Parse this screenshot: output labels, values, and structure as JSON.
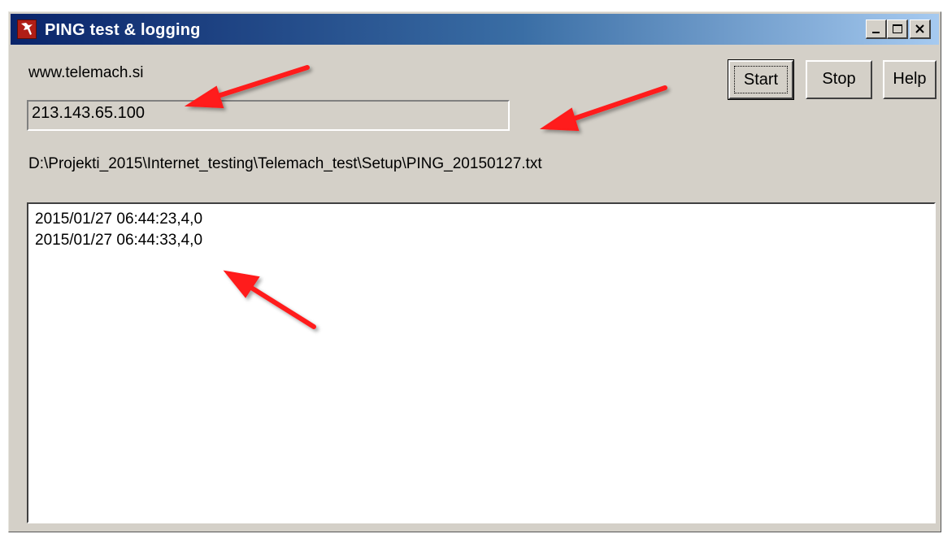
{
  "window": {
    "title": "PING test & logging",
    "icon": "app-icon",
    "caption_buttons": [
      "minimize-icon",
      "maximize-icon",
      "close-icon"
    ]
  },
  "form": {
    "host": "www.telemach.si",
    "ip_value": "213.143.65.100",
    "log_path": "D:\\Projekti_2015\\Internet_testing\\Telemach_test\\Setup\\PING_20150127.txt"
  },
  "buttons": {
    "start_label": "Start",
    "stop_label": "Stop",
    "help_label": "Help"
  },
  "log": {
    "lines": [
      "2015/01/27 06:44:23,4,0",
      "2015/01/27 06:44:33,4,0"
    ]
  },
  "colors": {
    "window_bg": "#d4d0c8",
    "titlebar_start": "#0a246a",
    "titlebar_end": "#a6caf0",
    "annotation_arrow": "#ff0000"
  }
}
